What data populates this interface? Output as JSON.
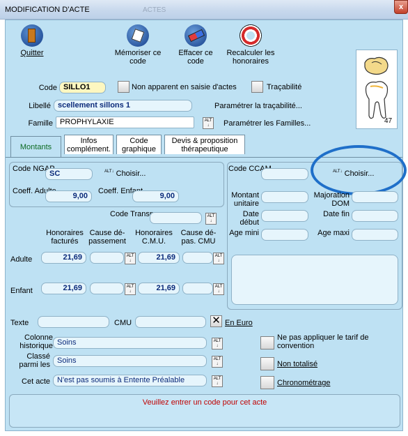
{
  "window": {
    "title": "MODIFICATION D'ACTE",
    "ghost_title": "ACTES",
    "close": "x"
  },
  "toolbar": {
    "quit": "Quitter",
    "memorize": "Mémoriser ce code",
    "erase": "Effacer ce code",
    "recalc": "Recalculer les honoraires"
  },
  "tooth": {
    "number": "47"
  },
  "header": {
    "code_label": "Code",
    "code_value": "SILLO1",
    "non_apparent": "Non apparent en saisie d'actes",
    "tracabilite": "Traçabilité",
    "libelle_label": "Libellé",
    "libelle_value": "scellement sillons 1",
    "param_trac": "Paramétrer la traçabilité...",
    "famille_label": "Famille",
    "famille_value": "PROPHYLAXIE",
    "param_fam": "Paramétrer les Familles..."
  },
  "tabs": [
    {
      "label": "Montants"
    },
    {
      "label": "Infos complément."
    },
    {
      "label": "Code graphique"
    },
    {
      "label": "Devis & proposition thérapeutique"
    }
  ],
  "ngap": {
    "code_label": "Code NGAP",
    "code_value": "SC",
    "choisir": "Choisir...",
    "coeff_adulte_label": "Coeff. Adulte",
    "coeff_adulte": "9,00",
    "coeff_enfant_label": "Coeff. Enfant",
    "coeff_enfant": "9,00",
    "transpo_label": "Code Transpo",
    "col_hon": "Honoraires facturés",
    "col_cause1": "Cause dé-passement",
    "col_cmu": "Honoraires C.M.U.",
    "col_cause2": "Cause dé-pas. CMU",
    "adulte_label": "Adulte",
    "adulte_hon": "21,69",
    "adulte_cmu": "21,69",
    "enfant_label": "Enfant",
    "enfant_hon": "21,69",
    "enfant_cmu": "21,69"
  },
  "ccam": {
    "code_label": "Code CCAM",
    "choisir": "Choisir...",
    "montant": "Montant unitaire",
    "majoration": "Majoration DOM",
    "date_debut": "Date début",
    "date_fin": "Date fin",
    "age_mini": "Age mini",
    "age_maxi": "Age maxi"
  },
  "bottom": {
    "texte": "Texte",
    "cmu": "CMU",
    "en_euro": "En Euro",
    "colonne_label": "Colonne historique",
    "colonne_value": "Soins",
    "classe_label": "Classé parmi les",
    "classe_value": "Soins",
    "cet_acte_label": "Cet acte",
    "cet_acte_value": "N'est pas soumis à Entente Préalable",
    "ne_pas": "Ne pas appliquer le tarif de convention",
    "non_totalise": "Non totalisé",
    "chrono": "Chronométrage"
  },
  "status": {
    "message": "Veuillez entrer un code pour cet acte"
  },
  "colors": {
    "highlight": "#1f6fc9",
    "status_text": "#c00000"
  }
}
